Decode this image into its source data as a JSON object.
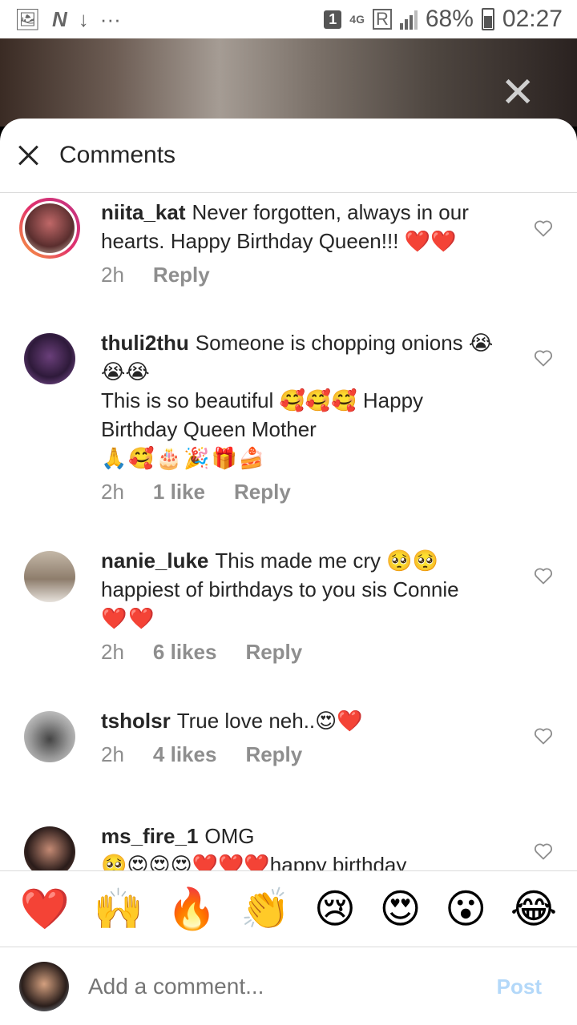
{
  "status_bar": {
    "badge": "1",
    "network": "4G",
    "battery": "68%",
    "time": "02:27"
  },
  "sheet": {
    "title": "Comments"
  },
  "comments": [
    {
      "username": "niita_kat",
      "text": "Never forgotten, always in our hearts. Happy Birthday Queen!!! ❤️❤️",
      "time": "2h",
      "likes": "",
      "reply": "Reply"
    },
    {
      "username": "thuli2thu",
      "text": "Someone is chopping onions 😭😭😭",
      "text2": "This is so beautiful 🥰🥰🥰 Happy Birthday Queen Mother",
      "text3": "🙏🥰🎂🎉🎁🍰",
      "time": "2h",
      "likes": "1 like",
      "reply": "Reply"
    },
    {
      "username": "nanie_luke",
      "text": "This made me cry 🥺🥺",
      "text2": "happiest of birthdays to you sis Connie",
      "text3": "❤️❤️",
      "time": "2h",
      "likes": "6 likes",
      "reply": "Reply"
    },
    {
      "username": "tsholsr",
      "text": "True love neh..😍❤️",
      "time": "2h",
      "likes": "4 likes",
      "reply": "Reply"
    },
    {
      "username": "ms_fire_1",
      "text": "OMG",
      "text2": "🥺😍😍😍❤️❤️❤️happy birthday"
    }
  ],
  "emoji_bar": [
    "❤️",
    "🙌",
    "🔥",
    "👏",
    "😢",
    "😍",
    "😮",
    "😂"
  ],
  "compose": {
    "placeholder": "Add a comment...",
    "post_label": "Post"
  }
}
